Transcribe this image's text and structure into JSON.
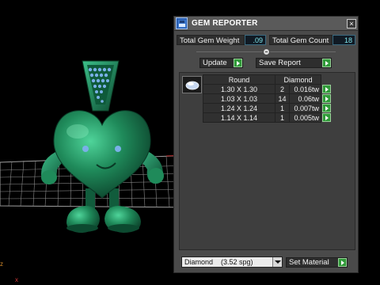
{
  "viewport": {
    "axis_z": "z",
    "axis_x": "x"
  },
  "panel": {
    "title": "GEM REPORTER",
    "close_glyph": "×",
    "total_weight_label": "Total Gem Weight",
    "total_weight_value": ".09",
    "total_count_label": "Total Gem Count",
    "total_count_value": "18",
    "update_label": "Update",
    "save_report_label": "Save Report",
    "table": {
      "headers": [
        "Round",
        "Diamond"
      ],
      "rows": [
        {
          "size": "1.30 X 1.30",
          "qty": "2",
          "weight": "0.016tw"
        },
        {
          "size": "1.03 X 1.03",
          "qty": "14",
          "weight": "0.06tw"
        },
        {
          "size": "1.24 X 1.24",
          "qty": "1",
          "weight": "0.007tw"
        },
        {
          "size": "1.14 X 1.14",
          "qty": "1",
          "weight": "0.005tw"
        }
      ]
    },
    "material_value": "Diamond    (3.52 spg)",
    "set_material_label": "Set Material"
  },
  "colors": {
    "model": "#1f8a5a",
    "gems": "#7ab0e8",
    "grid": "#9a9a9a",
    "accent_green": "#2f9a38",
    "value_text": "#7ee3e8"
  },
  "icons": [
    "app-logo-icon",
    "close-icon",
    "gem-icon",
    "arrow-right-icon",
    "chevron-down-icon"
  ]
}
